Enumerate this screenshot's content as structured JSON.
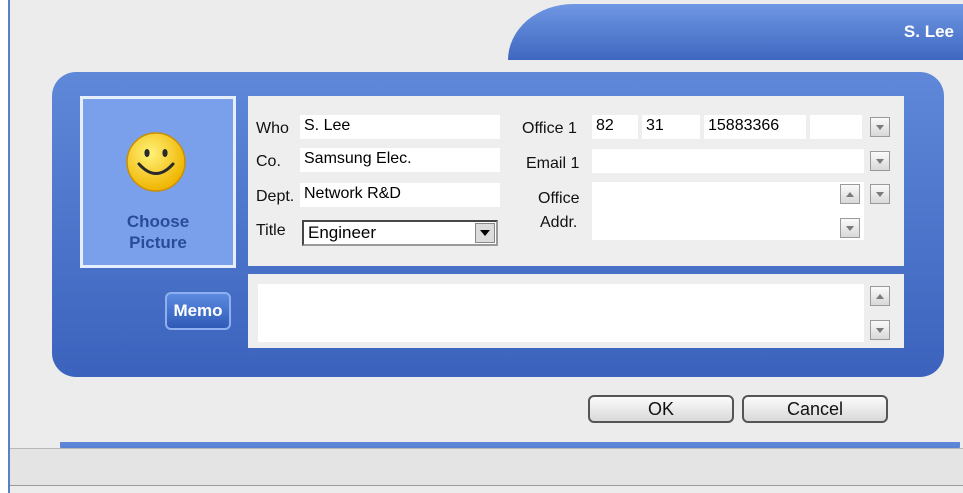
{
  "header": {
    "title": "S. Lee"
  },
  "picture": {
    "label_line1": "Choose",
    "label_line2": "Picture"
  },
  "form": {
    "who_label": "Who",
    "who_value": "S. Lee",
    "co_label": "Co.",
    "co_value": "Samsung Elec.",
    "dept_label": "Dept.",
    "dept_value": "Network R&D",
    "title_label": "Title",
    "title_value": "Engineer",
    "office1_label": "Office 1",
    "office1_values": [
      "82",
      "31",
      "15883366",
      ""
    ],
    "email1_label": "Email 1",
    "email1_value": "",
    "office_addr_label_line1": "Office",
    "office_addr_label_line2": "Addr.",
    "office_addr_value": ""
  },
  "memo": {
    "button_label": "Memo",
    "value": ""
  },
  "buttons": {
    "ok": "OK",
    "cancel": "Cancel"
  },
  "colors": {
    "accent": "#4a72c9",
    "panel": "#3b63bd",
    "face": "#eeeeee"
  }
}
